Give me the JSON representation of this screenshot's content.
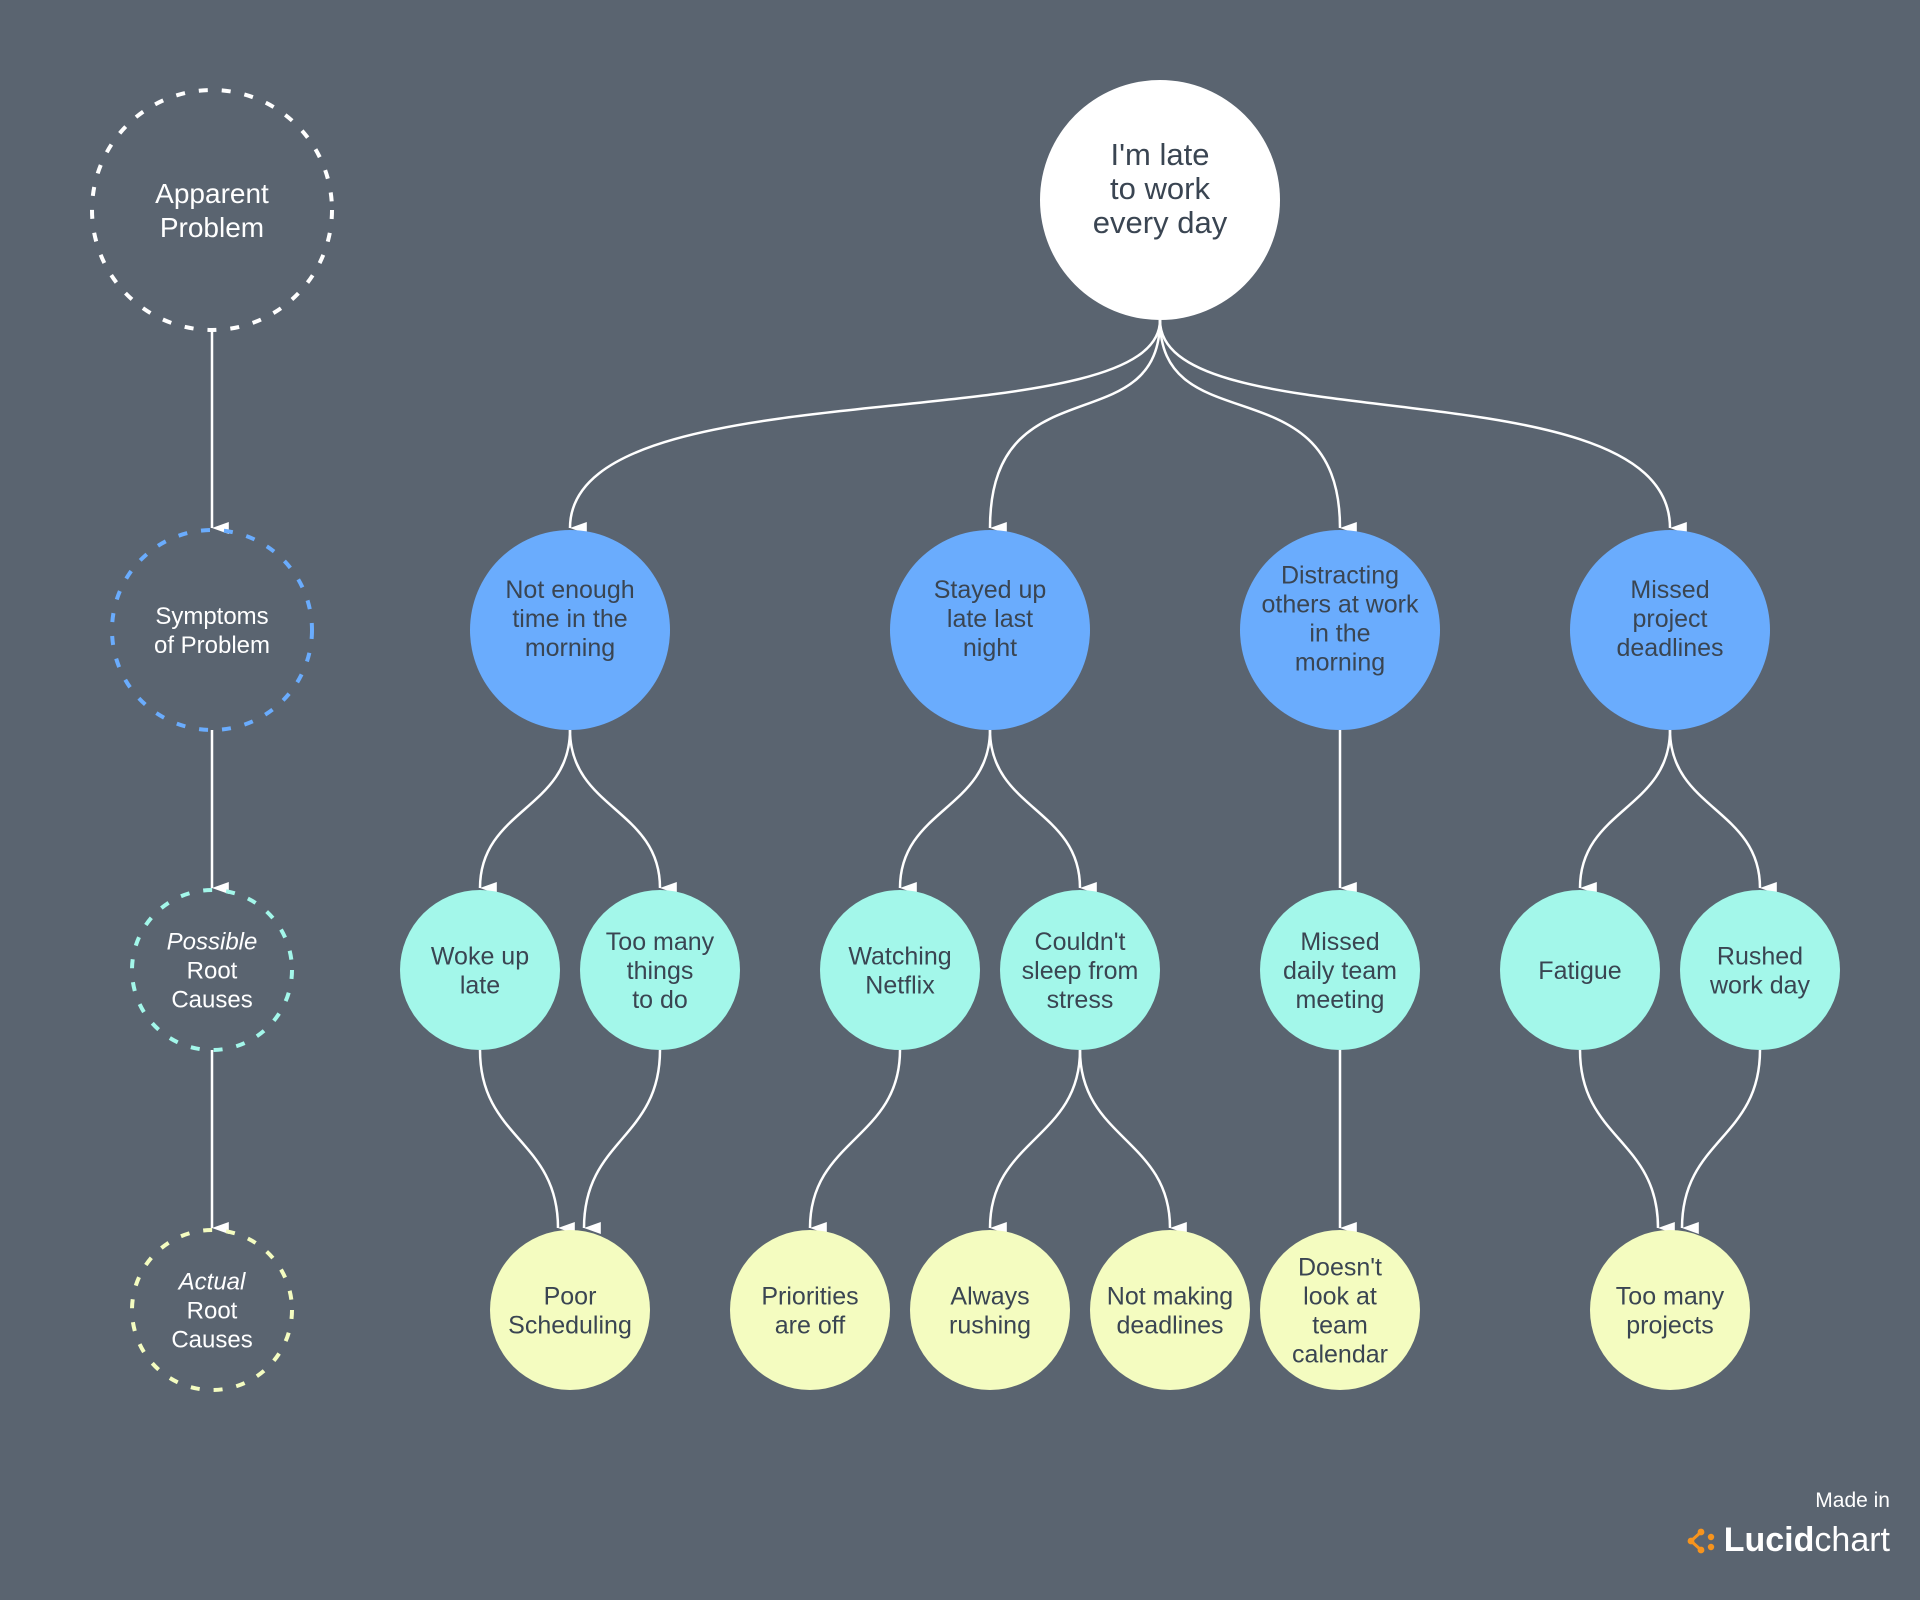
{
  "colors": {
    "background": "#5a6470",
    "problem": "#ffffff",
    "symptom": "#6aacfd",
    "possible": "#a3f7ea",
    "actual": "#f4fcc0",
    "text_dark": "#3a4552",
    "connector": "#ffffff",
    "lucid_orange": "#f7941d"
  },
  "legend": [
    {
      "id": "apparent",
      "lines": [
        {
          "text": "Apparent"
        },
        {
          "text": "Problem"
        }
      ],
      "color": "#ffffff"
    },
    {
      "id": "symptoms",
      "lines": [
        {
          "text": "Symptoms"
        },
        {
          "text": "of Problem"
        }
      ],
      "color": "#6aacfd"
    },
    {
      "id": "possible",
      "lines": [
        {
          "text": "Possible",
          "italic": true
        },
        {
          "text": "Root"
        },
        {
          "text": "Causes"
        }
      ],
      "color": "#a3f7ea"
    },
    {
      "id": "actual",
      "lines": [
        {
          "text": "Actual",
          "italic": true
        },
        {
          "text": "Root"
        },
        {
          "text": "Causes"
        }
      ],
      "color": "#f4fcc0"
    }
  ],
  "nodes": [
    {
      "id": "problem",
      "level": "problem",
      "lines": [
        "I'm late",
        "to work",
        "every day"
      ]
    },
    {
      "id": "s1",
      "level": "symptom",
      "lines": [
        "Not enough",
        "time in the",
        "morning"
      ]
    },
    {
      "id": "s2",
      "level": "symptom",
      "lines": [
        "Stayed up",
        "late last",
        "night"
      ]
    },
    {
      "id": "s3",
      "level": "symptom",
      "lines": [
        "Distracting",
        "others at work",
        "in the",
        "morning"
      ]
    },
    {
      "id": "s4",
      "level": "symptom",
      "lines": [
        "Missed",
        "project",
        "deadlines"
      ]
    },
    {
      "id": "p1",
      "level": "possible",
      "lines": [
        "Woke up",
        "late"
      ]
    },
    {
      "id": "p2",
      "level": "possible",
      "lines": [
        "Too many",
        "things",
        "to do"
      ]
    },
    {
      "id": "p3",
      "level": "possible",
      "lines": [
        "Watching",
        "Netflix"
      ]
    },
    {
      "id": "p4",
      "level": "possible",
      "lines": [
        "Couldn't",
        "sleep from",
        "stress"
      ]
    },
    {
      "id": "p5",
      "level": "possible",
      "lines": [
        "Missed",
        "daily team",
        "meeting"
      ]
    },
    {
      "id": "p6",
      "level": "possible",
      "lines": [
        "Fatigue"
      ]
    },
    {
      "id": "p7",
      "level": "possible",
      "lines": [
        "Rushed",
        "work day"
      ]
    },
    {
      "id": "a1",
      "level": "actual",
      "lines": [
        "Poor",
        "Scheduling"
      ]
    },
    {
      "id": "a2",
      "level": "actual",
      "lines": [
        "Priorities",
        "are off"
      ]
    },
    {
      "id": "a3",
      "level": "actual",
      "lines": [
        "Always",
        "rushing"
      ]
    },
    {
      "id": "a4",
      "level": "actual",
      "lines": [
        "Not making",
        "deadlines"
      ]
    },
    {
      "id": "a5",
      "level": "actual",
      "lines": [
        "Doesn't",
        "look at",
        "team",
        "calendar"
      ]
    },
    {
      "id": "a6",
      "level": "actual",
      "lines": [
        "Too many",
        "projects"
      ]
    }
  ],
  "edges": [
    [
      "problem",
      "s1"
    ],
    [
      "problem",
      "s2"
    ],
    [
      "problem",
      "s3"
    ],
    [
      "problem",
      "s4"
    ],
    [
      "s1",
      "p1"
    ],
    [
      "s1",
      "p2"
    ],
    [
      "s2",
      "p3"
    ],
    [
      "s2",
      "p4"
    ],
    [
      "s3",
      "p5"
    ],
    [
      "s4",
      "p6"
    ],
    [
      "s4",
      "p7"
    ],
    [
      "p1",
      "a1"
    ],
    [
      "p2",
      "a1"
    ],
    [
      "p3",
      "a2"
    ],
    [
      "p4",
      "a3"
    ],
    [
      "p4",
      "a4"
    ],
    [
      "p5",
      "a5"
    ],
    [
      "p6",
      "a6"
    ],
    [
      "p7",
      "a6"
    ]
  ],
  "legend_edges": [
    [
      "apparent",
      "symptoms"
    ],
    [
      "symptoms",
      "possible"
    ],
    [
      "possible",
      "actual"
    ]
  ],
  "watermark": {
    "made_in": "Made in",
    "brand_bold": "Lucid",
    "brand_light": "chart"
  }
}
